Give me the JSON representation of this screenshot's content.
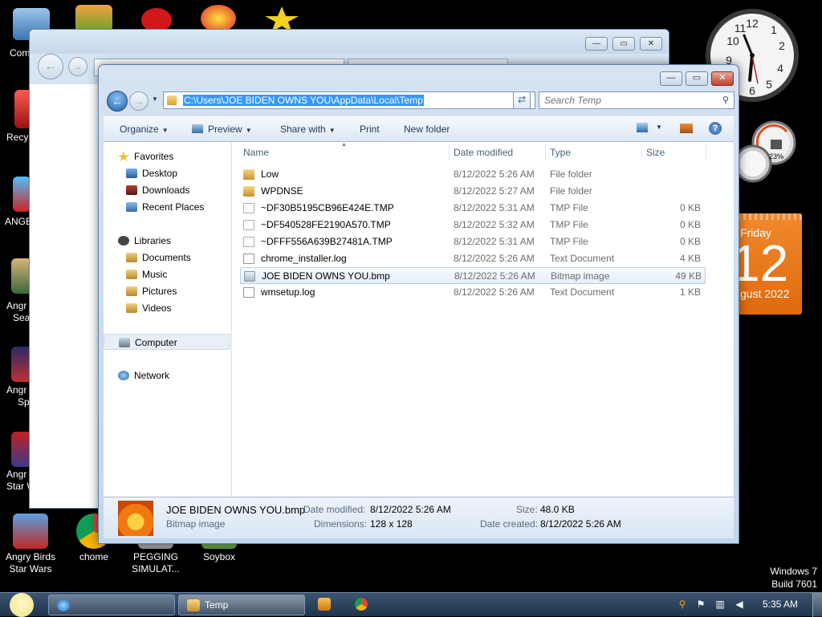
{
  "desktop": {
    "icons": [
      {
        "label": "Angry Birds Star Wars"
      },
      {
        "label": "chome"
      },
      {
        "label": "PEGGING SIMULAT..."
      },
      {
        "label": "Soybox"
      }
    ],
    "partial_labels": {
      "computer": "Com",
      "recycle": "Recy",
      "angry1": "ANGE",
      "angry2a": "Angr",
      "angry2b": "Sea",
      "angry3a": "Angr",
      "angry3b": "Sp",
      "angry4a": "Angr",
      "angry4b": "Star W"
    },
    "windows_version": {
      "line1": "Windows 7",
      "line2": "Build 7601"
    }
  },
  "gadgets": {
    "meter_percent": "23%",
    "calendar": {
      "day": "Friday",
      "date": "12",
      "month": "gust 2022"
    }
  },
  "explorer": {
    "address": "C:\\Users\\JOE BIDEN OWNS YOU\\AppData\\Local\\Temp",
    "search_placeholder": "Search Temp",
    "toolbar": {
      "organize": "Organize",
      "preview": "Preview",
      "share_with": "Share with",
      "print": "Print",
      "new_folder": "New folder"
    },
    "nav": {
      "favorites": "Favorites",
      "desktop": "Desktop",
      "downloads": "Downloads",
      "recent_places": "Recent Places",
      "libraries": "Libraries",
      "documents": "Documents",
      "music": "Music",
      "pictures": "Pictures",
      "videos": "Videos",
      "computer": "Computer",
      "network": "Network"
    },
    "columns": {
      "name": "Name",
      "date": "Date modified",
      "type": "Type",
      "size": "Size"
    },
    "files": [
      {
        "name": "Low",
        "date": "8/12/2022 5:26 AM",
        "type": "File folder",
        "size": "",
        "icon": "folder-icon"
      },
      {
        "name": "WPDNSE",
        "date": "8/12/2022 5:27 AM",
        "type": "File folder",
        "size": "",
        "icon": "folder-icon"
      },
      {
        "name": "~DF30B5195CB96E424E.TMP",
        "date": "8/12/2022 5:31 AM",
        "type": "TMP File",
        "size": "0 KB",
        "icon": "file-icon"
      },
      {
        "name": "~DF540528FE2190A570.TMP",
        "date": "8/12/2022 5:32 AM",
        "type": "TMP File",
        "size": "0 KB",
        "icon": "file-icon"
      },
      {
        "name": "~DFFF556A639B27481A.TMP",
        "date": "8/12/2022 5:31 AM",
        "type": "TMP File",
        "size": "0 KB",
        "icon": "file-icon"
      },
      {
        "name": "chrome_installer.log",
        "date": "8/12/2022 5:26 AM",
        "type": "Text Document",
        "size": "4 KB",
        "icon": "text-file-icon"
      },
      {
        "name": "JOE BIDEN OWNS YOU.bmp",
        "date": "8/12/2022 5:26 AM",
        "type": "Bitmap image",
        "size": "49 KB",
        "icon": "image-file-icon"
      },
      {
        "name": "wmsetup.log",
        "date": "8/12/2022 5:26 AM",
        "type": "Text Document",
        "size": "1 KB",
        "icon": "text-file-icon"
      }
    ],
    "details": {
      "filename": "JOE BIDEN OWNS YOU.bmp",
      "filetype": "Bitmap image",
      "date_modified_label": "Date modified:",
      "date_modified": "8/12/2022 5:26 AM",
      "dimensions_label": "Dimensions:",
      "dimensions": "128 x 128",
      "size_label": "Size:",
      "size": "48.0 KB",
      "date_created_label": "Date created:",
      "date_created": "8/12/2022 5:26 AM"
    }
  },
  "taskbar": {
    "task_temp": "Temp",
    "time": "5:35 AM"
  },
  "colors": {
    "selection": "#3399ff",
    "calendar": "#e8761c",
    "taskbar": "#2b4058"
  }
}
